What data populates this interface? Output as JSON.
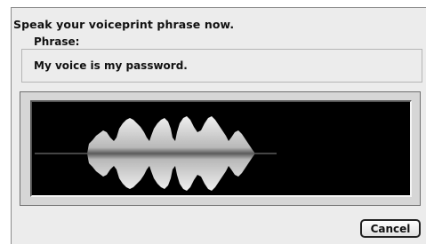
{
  "dialog": {
    "prompt": "Speak your voiceprint phrase now.",
    "phrase_label": "Phrase:",
    "phrase_text": "My voice is my password."
  },
  "waveform": {
    "background_color": "#000000",
    "fill_color": "#c8c8c8",
    "baseline_color": "#8a8a8a"
  },
  "buttons": {
    "cancel_label": "Cancel"
  }
}
